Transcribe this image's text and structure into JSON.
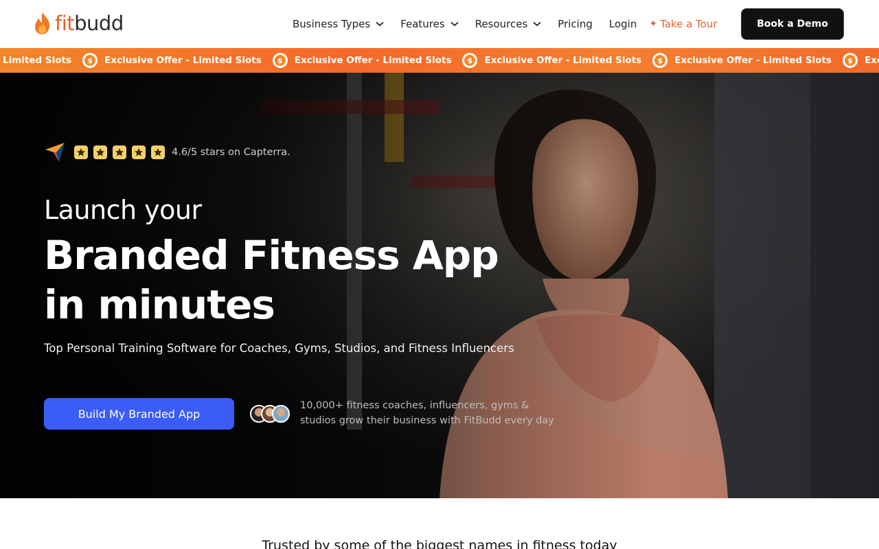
{
  "brand": {
    "logo_fit": "fit",
    "logo_budd": "budd",
    "accent_color": "#e8612c"
  },
  "nav": {
    "items": [
      {
        "label": "Business Types",
        "has_dropdown": true
      },
      {
        "label": "Features",
        "has_dropdown": true
      },
      {
        "label": "Resources",
        "has_dropdown": true
      },
      {
        "label": "Pricing",
        "has_dropdown": false
      },
      {
        "label": "Login",
        "has_dropdown": false
      }
    ],
    "tour_label": "Take a Tour",
    "tour_icon": "sparkle-icon",
    "book_demo_label": "Book a Demo"
  },
  "ticker": {
    "lead_text": "Limited Slots",
    "segment_text": "Exclusive Offer - Limited Slots",
    "tail_text": "Exclusive",
    "coin_icon": "dollar-coin-icon",
    "color": "#f4692a"
  },
  "hero": {
    "rating_text": "4.6/5 stars on Capterra.",
    "star_count": 5,
    "subtitle": "Launch your",
    "title_line1": "Branded Fitness App",
    "title_line2": "in minutes",
    "description": "Top Personal Training Software for Coaches, Gyms, Studios, and Fitness Influencers",
    "cta_label": "Build My Branded App",
    "cta_color": "#3b5cf6",
    "social_line1": "10,000+ fitness coaches, influencers, gyms &",
    "social_line2": "studios grow their business with FitBudd every day"
  },
  "trusted": {
    "heading": "Trusted by some of the biggest names in fitness today"
  }
}
